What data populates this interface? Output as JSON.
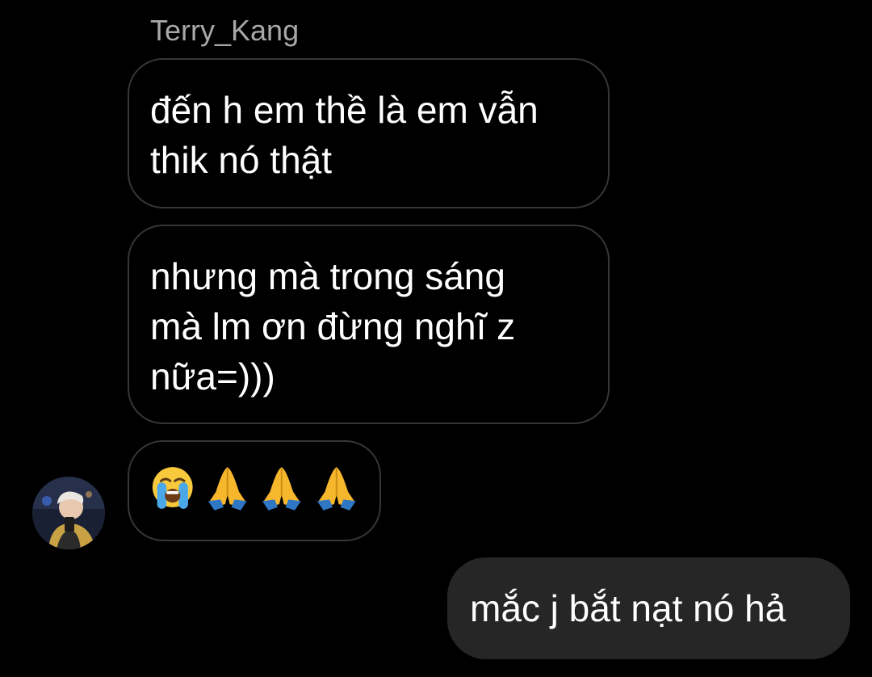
{
  "conversation": {
    "sender_name": "Terry_Kang",
    "incoming": [
      {
        "lines": [
          "đến h em thề là em vẫn",
          "thik nó thật"
        ]
      },
      {
        "lines": [
          "nhưng mà trong sáng",
          "mà lm ơn đừng nghĩ z",
          "nữa=)))"
        ]
      },
      {
        "emojis": [
          "loudly-crying-face-icon",
          "folded-hands-icon",
          "folded-hands-icon",
          "folded-hands-icon"
        ]
      }
    ],
    "outgoing": [
      {
        "text": "mắc j bắt nạt nó hả"
      }
    ]
  },
  "colors": {
    "background": "#000000",
    "incoming_border": "#363636",
    "outgoing_bubble": "#262626",
    "sender_name": "#a8a8a8",
    "text": "#ffffff"
  }
}
